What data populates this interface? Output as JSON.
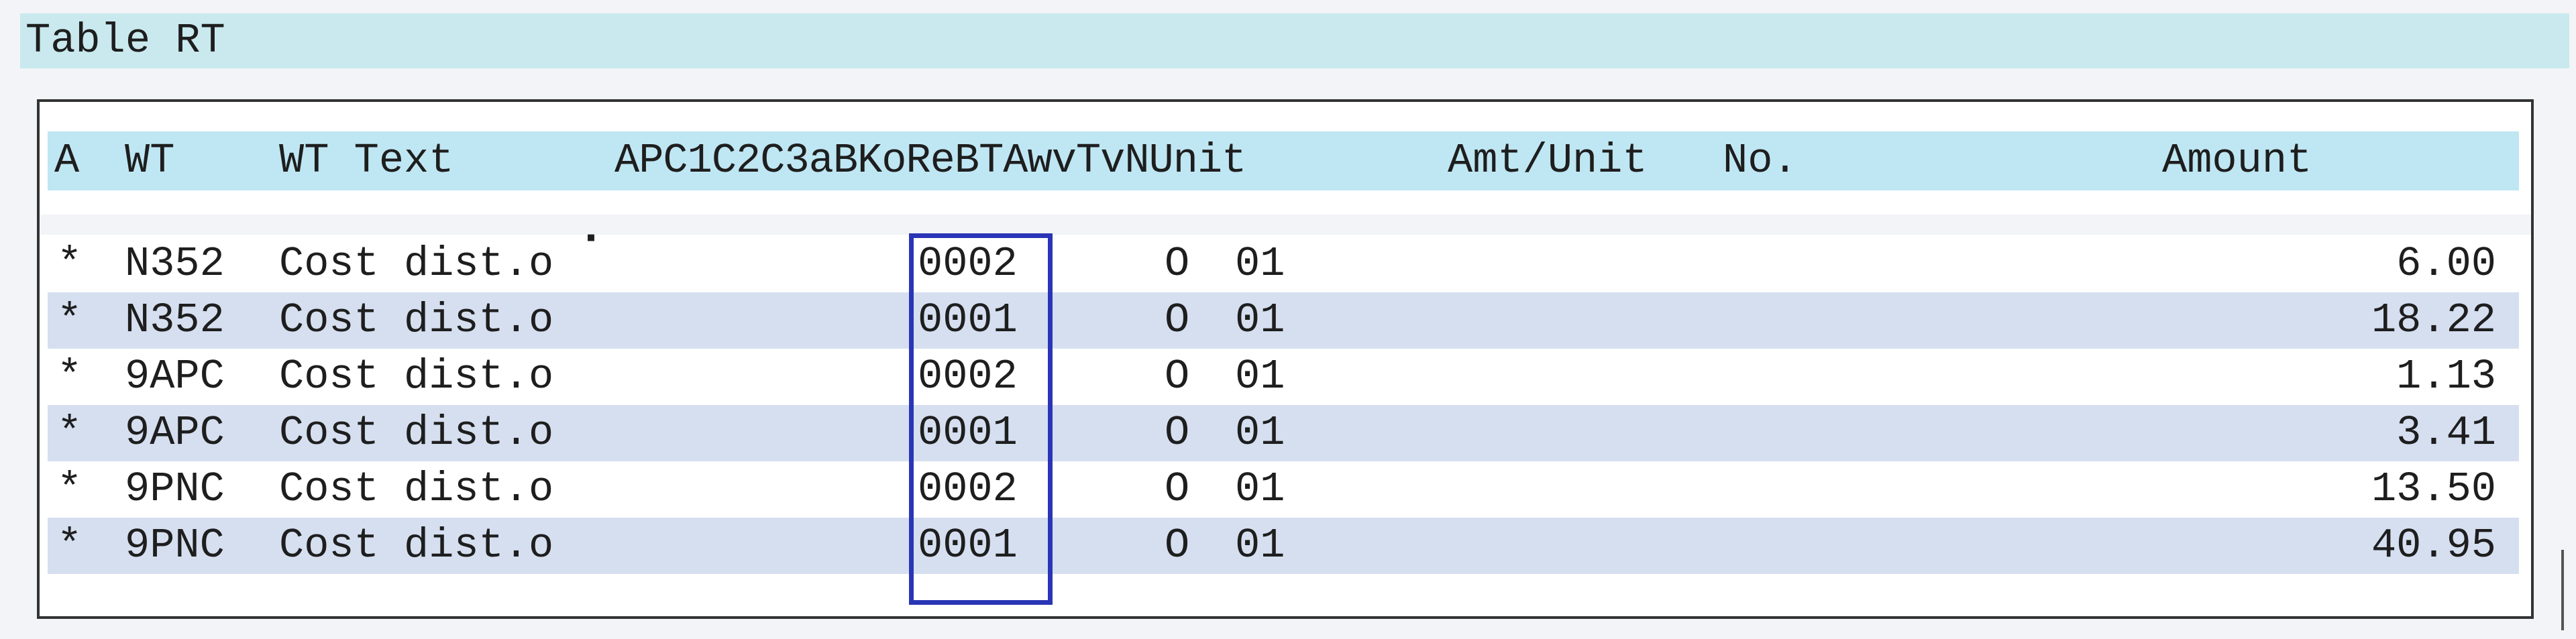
{
  "window": {
    "title": "Table RT"
  },
  "table": {
    "headers": {
      "a": "A",
      "wt": "WT",
      "wt_text": "WT Text",
      "codes": "APC1C2C3aBKoReBTAwvTvNUnit",
      "amt_unit": "Amt/Unit",
      "no": "No.",
      "amount": "Amount"
    },
    "rows": [
      {
        "a": "*",
        "wt": "N352",
        "wt_text": "Cost dist.o",
        "code": "0002",
        "flag": "O",
        "num": "01",
        "amount": "6.00"
      },
      {
        "a": "*",
        "wt": "N352",
        "wt_text": "Cost dist.o",
        "code": "0001",
        "flag": "O",
        "num": "01",
        "amount": "18.22"
      },
      {
        "a": "*",
        "wt": "9APC",
        "wt_text": "Cost dist.o",
        "code": "0002",
        "flag": "O",
        "num": "01",
        "amount": "1.13"
      },
      {
        "a": "*",
        "wt": "9APC",
        "wt_text": "Cost dist.o",
        "code": "0001",
        "flag": "O",
        "num": "01",
        "amount": "3.41"
      },
      {
        "a": "*",
        "wt": "9PNC",
        "wt_text": "Cost dist.o",
        "code": "0002",
        "flag": "O",
        "num": "01",
        "amount": "13.50"
      },
      {
        "a": "*",
        "wt": "9PNC",
        "wt_text": "Cost dist.o",
        "code": "0001",
        "flag": "O",
        "num": "01",
        "amount": "40.95"
      }
    ]
  },
  "colors": {
    "title_bg": "#c9e9ee",
    "header_bg": "#bfe6f3",
    "alt_row_bg": "#d5dff0",
    "highlight_border": "#2a35b6"
  }
}
